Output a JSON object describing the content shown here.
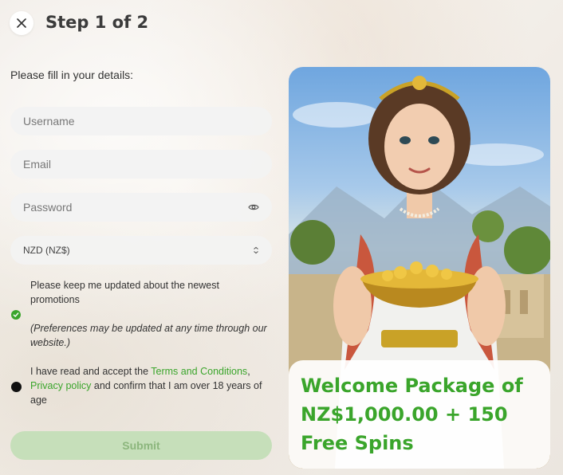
{
  "header": {
    "title": "Step 1 of 2"
  },
  "form": {
    "subtitle": "Please fill in your details:",
    "username_placeholder": "Username",
    "email_placeholder": "Email",
    "password_placeholder": "Password",
    "currency_value": "NZD (NZ$)",
    "promotions_label": "Please keep me updated about the newest promotions",
    "preferences_note": "(Preferences may be updated at any time through our website.)",
    "terms_prefix": "I have read and accept the ",
    "terms_link": "Terms and Conditions",
    "terms_comma": ",",
    "privacy_link": "Privacy policy",
    "terms_suffix": " and confirm that I am over 18 years of age",
    "submit_label": "Submit"
  },
  "promo": {
    "text": "Welcome Package of NZ$1,000.00 + 150 Free Spins"
  },
  "colors": {
    "accent_green": "#3aa52b",
    "submit_disabled_bg": "#c6dfba",
    "submit_disabled_text": "#8cb67d"
  },
  "icons": [
    "close-icon",
    "eye-icon",
    "chevron-updown-icon",
    "check-icon"
  ]
}
